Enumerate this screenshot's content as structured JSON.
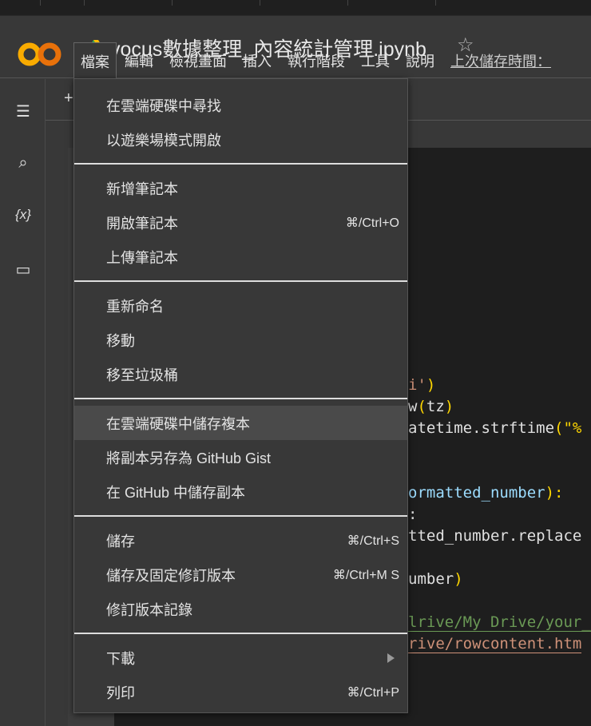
{
  "header": {
    "title": "vocus數據整理_內容統計管理.ipynb",
    "logo_text": "CO"
  },
  "menubar": [
    "檔案",
    "編輯",
    "檢視畫面",
    "插入",
    "執行階段",
    "工具",
    "說明"
  ],
  "last_saved": "上次儲存時間：",
  "code_fragments": [
    {
      "a": "i'",
      "b": ")"
    },
    {
      "a": "w",
      "b": "(",
      "c": "tz",
      "d": ")"
    },
    {
      "a": "atetime.strftime",
      "b": "(\"%"
    },
    {
      "a": "ormatted_number",
      "b": "):"
    },
    {
      "a": ":"
    },
    {
      "a": "tted_number.replace"
    },
    {
      "a": "umber",
      "b": ")"
    },
    {
      "a": "lrive/My Drive/your_"
    },
    {
      "a": "rive/rowcontent.htm"
    }
  ],
  "menu": {
    "groups": [
      [
        {
          "label": "在雲端硬碟中尋找"
        },
        {
          "label": "以遊樂場模式開啟"
        }
      ],
      [
        {
          "label": "新增筆記本"
        },
        {
          "label": "開啟筆記本",
          "shortcut": "⌘/Ctrl+O"
        },
        {
          "label": "上傳筆記本"
        }
      ],
      [
        {
          "label": "重新命名"
        },
        {
          "label": "移動"
        },
        {
          "label": "移至垃圾桶"
        }
      ],
      [
        {
          "label": "在雲端硬碟中儲存複本"
        },
        {
          "label": "將副本另存為 GitHub Gist"
        },
        {
          "label": "在 GitHub 中儲存副本"
        }
      ],
      [
        {
          "label": "儲存",
          "shortcut": "⌘/Ctrl+S"
        },
        {
          "label": "儲存及固定修訂版本",
          "shortcut": "⌘/Ctrl+M S"
        },
        {
          "label": "修訂版本記錄"
        }
      ],
      [
        {
          "label": "下載"
        },
        {
          "label": "列印",
          "shortcut": "⌘/Ctrl+P"
        }
      ]
    ]
  }
}
